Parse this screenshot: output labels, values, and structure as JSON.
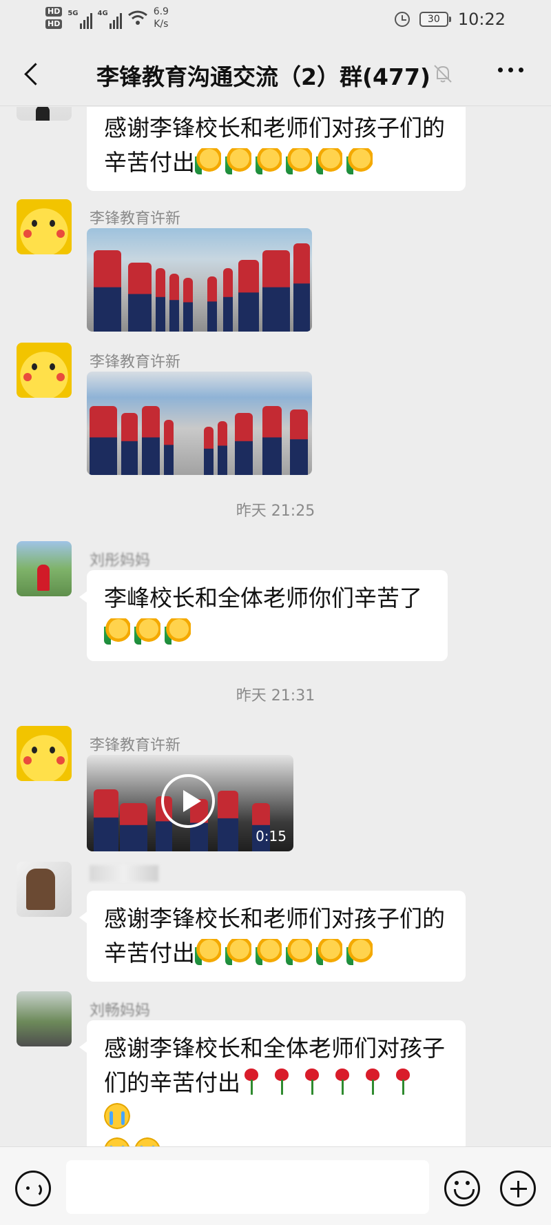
{
  "status_bar": {
    "hd1": "HD",
    "hd2": "HD",
    "net1": "5G",
    "net2": "4G",
    "speed_value": "6.9",
    "speed_unit": "K/s",
    "battery": "30",
    "time": "10:22"
  },
  "nav": {
    "title": "李锋教育沟通交流（2）群(477)"
  },
  "messages": [
    {
      "bubble_line1": "感谢李锋校长和老师们对孩子们的",
      "bubble_line2": "辛苦付出"
    },
    {
      "sender": "李锋教育许新"
    },
    {
      "sender": "李锋教育许新"
    },
    {
      "timestamp": "昨天 21:25"
    },
    {
      "sender": "刘彤妈妈",
      "bubble_line1": "李峰校长和全体老师你们辛苦了"
    },
    {
      "timestamp": "昨天 21:31"
    },
    {
      "sender": "李锋教育许新",
      "video_duration": "0:15"
    },
    {
      "bubble_line1": "感谢李锋校长和老师们对孩子们的",
      "bubble_line2": "辛苦付出"
    },
    {
      "sender": "刘畅妈妈",
      "bubble_line1": "感谢李锋校长和全体老师们对孩子",
      "bubble_line2": "们的辛苦付出"
    }
  ],
  "colors": {
    "background": "#ededed",
    "bubble": "#ffffff",
    "sender_text": "#8a8a8a"
  },
  "icons": [
    "back-icon",
    "mute-bell-icon",
    "more-icon",
    "voice-icon",
    "emoji-icon",
    "plus-icon",
    "play-icon",
    "thumbs-up-emoji",
    "rose-emoji",
    "crying-emoji"
  ]
}
